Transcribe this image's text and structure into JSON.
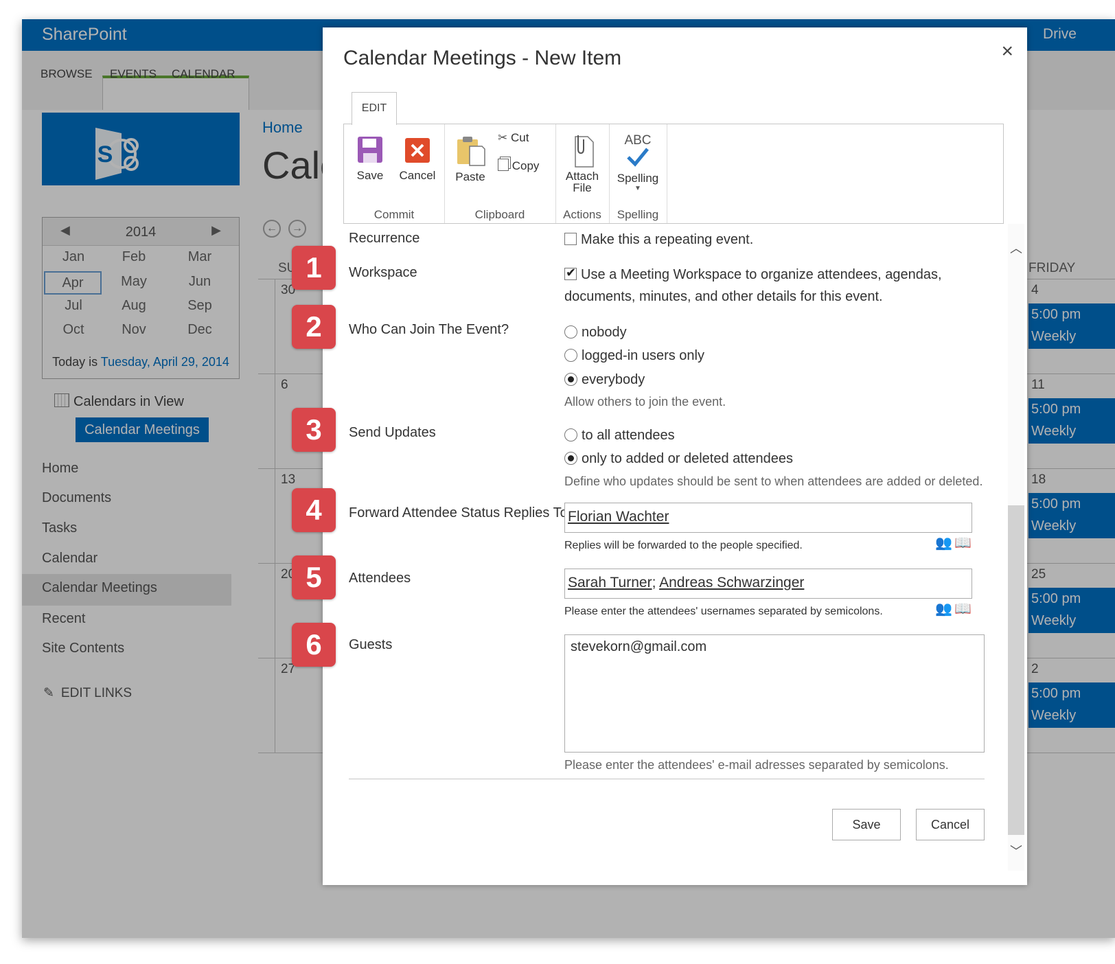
{
  "suite": {
    "brand": "SharePoint",
    "right_label": "Drive"
  },
  "ribbon_tabs": [
    "BROWSE",
    "EVENTS",
    "CALENDAR"
  ],
  "breadcrumb": "Home",
  "page_title": "Cale",
  "mini_calendar": {
    "year": "2014",
    "months": [
      "Jan",
      "Feb",
      "Mar",
      "Apr",
      "May",
      "Jun",
      "Jul",
      "Aug",
      "Sep",
      "Oct",
      "Nov",
      "Dec"
    ],
    "selected_month": "Apr",
    "today_prefix": "Today is",
    "today_date": "Tuesday, April 29, 2014"
  },
  "calendars_in_view": {
    "label": "Calendars in View",
    "chip": "Calendar Meetings"
  },
  "quick_launch": [
    "Home",
    "Documents",
    "Tasks",
    "Calendar",
    "Calendar Meetings",
    "Recent",
    "Site Contents"
  ],
  "edit_links": "EDIT LINKS",
  "calendar_bg": {
    "weekday_left": "SU",
    "weekday_right": "FRIDAY",
    "left_days": [
      "30",
      "6",
      "13",
      "20",
      "27"
    ],
    "right_days": [
      "4",
      "11",
      "18",
      "25",
      "2"
    ],
    "event_time": "5:00 pm",
    "event_recur": "Weekly"
  },
  "dialog": {
    "title": "Calendar Meetings - New Item",
    "close_glyph": "×",
    "tab": "EDIT",
    "ribbon": {
      "save": "Save",
      "cancel": "Cancel",
      "commit": "Commit",
      "paste": "Paste",
      "cut": "Cut",
      "copy": "Copy",
      "clipboard": "Clipboard",
      "attach_line1": "Attach",
      "attach_line2": "File",
      "actions": "Actions",
      "abc": "ABC",
      "spelling": "Spelling",
      "spelling_group": "Spelling"
    },
    "form": {
      "recurrence_label": "Recurrence",
      "recurrence_text": "Make this a repeating event.",
      "workspace_label": "Workspace",
      "workspace_text1": "Use a Meeting Workspace to organize attendees, agendas,",
      "workspace_text2": "documents, minutes, and other details for this event.",
      "join_label": "Who Can Join The Event?",
      "join_options": [
        "nobody",
        "logged-in users only",
        "everybody"
      ],
      "join_selected": "everybody",
      "join_hint": "Allow others to join the event.",
      "updates_label": "Send Updates",
      "updates_options": [
        "to all attendees",
        "only to added or deleted attendees"
      ],
      "updates_selected": "only to added or deleted attendees",
      "updates_hint": "Define who updates should be sent to when attendees are added or deleted.",
      "forward_label": "Forward Attendee Status Replies To",
      "forward_value": "Florian Wachter",
      "forward_hint": "Replies will be forwarded to the people specified.",
      "attendees_label": "Attendees",
      "attendee_1": "Sarah Turner",
      "attendee_sep": ";",
      "attendee_2": "Andreas Schwarzinger",
      "attendees_hint": "Please enter the attendees' usernames separated by semicolons.",
      "guests_label": "Guests",
      "guests_value": "stevekorn@gmail.com",
      "guests_hint": "Please enter the attendees' e-mail adresses separated by semicolons.",
      "save_button": "Save",
      "cancel_button": "Cancel"
    }
  },
  "badges": [
    "1",
    "2",
    "3",
    "4",
    "5",
    "6"
  ],
  "colors": {
    "accent": "#0072c6",
    "badge": "#d9464b",
    "cancel_red": "#e04b2a",
    "save_purple": "#9b59b6"
  }
}
